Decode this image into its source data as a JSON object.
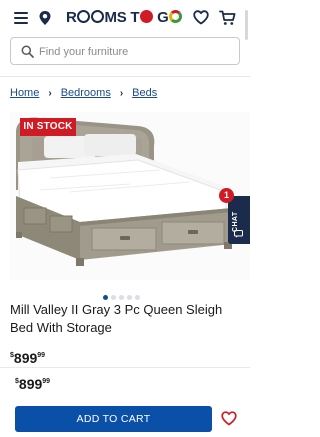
{
  "header": {
    "logo_parts": [
      "R",
      "O",
      "O",
      "MS",
      "T",
      "O",
      "G",
      "O"
    ],
    "logo_text": "ROOMS TO GO",
    "icons": [
      "menu-icon",
      "location-pin-icon",
      "heart-icon",
      "cart-icon"
    ]
  },
  "search": {
    "placeholder": "Find your furniture"
  },
  "breadcrumb": {
    "items": [
      {
        "label": "Home"
      },
      {
        "label": "Bedrooms"
      },
      {
        "label": "Beds"
      }
    ]
  },
  "product": {
    "stock_badge": "IN STOCK",
    "title": "Mill Valley II Gray 3 Pc Queen Sleigh Bed With Storage",
    "price_dollars": "899",
    "price_cents": "99",
    "image_count": 5,
    "active_image": 1
  },
  "chat": {
    "label": "CHAT",
    "badge_count": "1"
  },
  "sticky_bar": {
    "price_dollars": "899",
    "price_cents": "99",
    "add_to_cart_label": "ADD TO CART"
  },
  "colors": {
    "brand_navy": "#1a2b4c",
    "link_blue": "#1a4b8c",
    "button_blue": "#0a4fa8",
    "badge_red": "#d01a24",
    "wishlist_red": "#d01a24"
  }
}
